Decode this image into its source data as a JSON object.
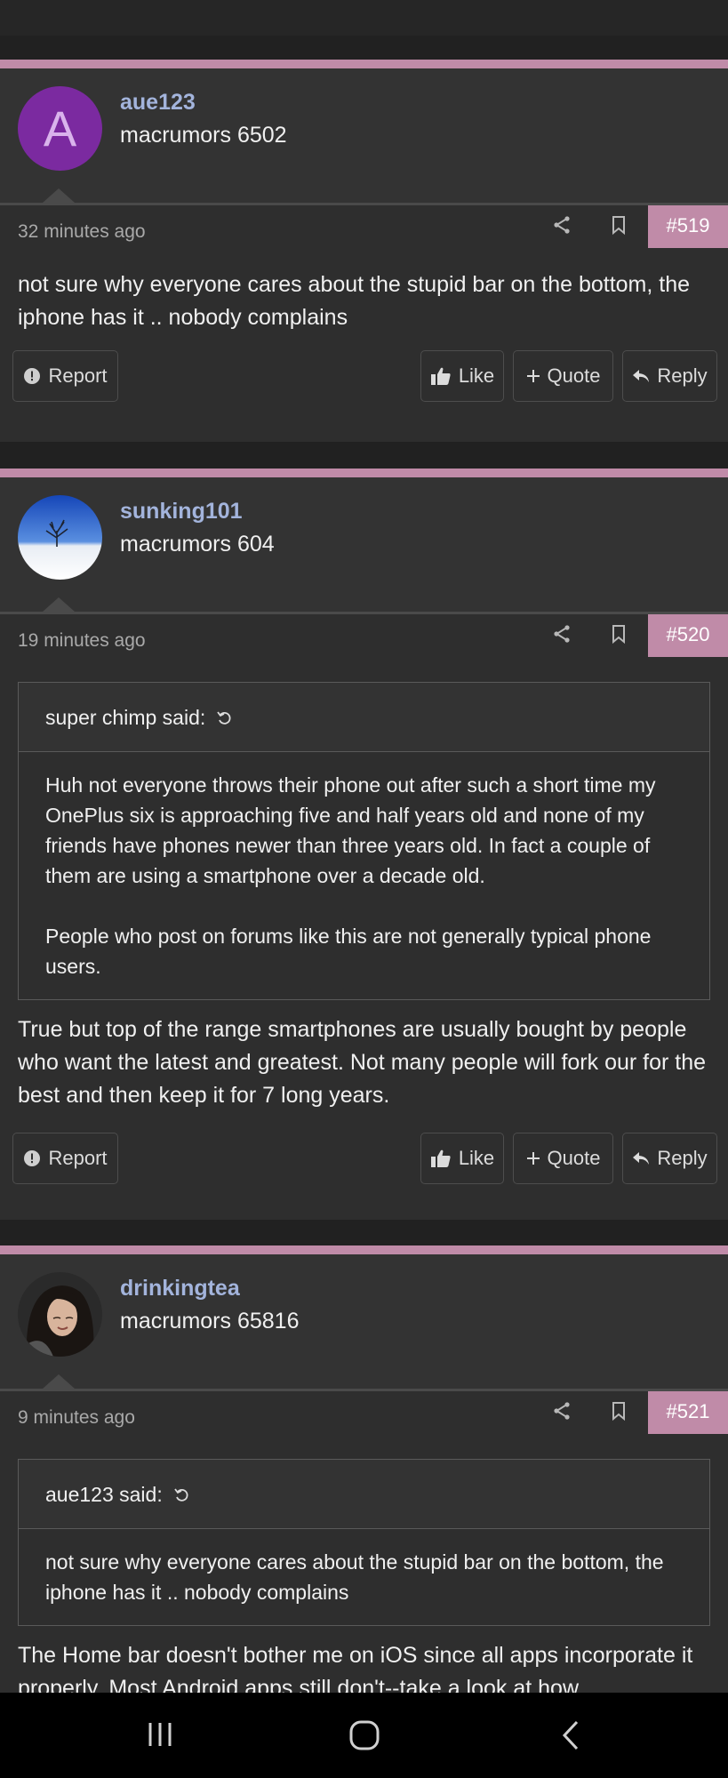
{
  "actions": {
    "report": "Report",
    "like": "Like",
    "quote": "Quote",
    "reply": "Reply"
  },
  "posts": [
    {
      "avatar_letter": "A",
      "username": "aue123",
      "user_title": "macrumors 6502",
      "time": "32 minutes ago",
      "number": "#519",
      "text": "not sure why everyone cares about the stupid bar on the bottom, the iphone has it .. nobody complains"
    },
    {
      "username": "sunking101",
      "user_title": "macrumors 604",
      "time": "19 minutes ago",
      "number": "#520",
      "quote": {
        "author": "super chimp said:",
        "para1": "Huh not everyone throws their phone out after such a short time my OnePlus six is approaching five and half years old and none of my friends have phones newer than three years old. In fact a couple of them are using a smartphone over a decade old.",
        "para2": "People who post on forums like this are not generally typical phone users."
      },
      "text": "True but top of the range smartphones are usually bought by people who want the latest and greatest. Not many people will fork our for the best and then keep it for 7 long years."
    },
    {
      "username": "drinkingtea",
      "user_title": "macrumors 65816",
      "time": "9 minutes ago",
      "number": "#521",
      "quote": {
        "author": "aue123 said:",
        "para1": "not sure why everyone cares about the stupid bar on the bottom, the iphone has it .. nobody complains"
      },
      "text": "The Home bar doesn't bother me on iOS since all apps incorporate it properly. Most Android apps still don't--take a look at how"
    }
  ],
  "colors": {
    "accent": "#c08ba8",
    "username": "#a3b4dc",
    "background": "#212121"
  },
  "icons": [
    "share-icon",
    "bookmark-icon",
    "alert-icon",
    "thumbs-up-icon",
    "plus-icon",
    "reply-icon",
    "recent-apps-icon",
    "home-icon",
    "back-icon"
  ]
}
